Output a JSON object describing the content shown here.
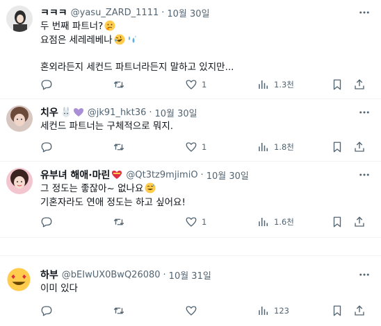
{
  "tweets": [
    {
      "name": "ㅋㅋㅋ",
      "handle": "@yasu_ZARD_1111",
      "time": "10월 30일",
      "lines": [
        "두 번째 파트너?",
        "요점은 세레레베나",
        "",
        "혼외라든지 세컨드 파트너라든지 말하고 있지만..."
      ],
      "reply_count": "",
      "retweet_count": "",
      "like_count": "1",
      "views": "1.3천"
    },
    {
      "name": "치우",
      "handle": "@jk91_hkt36",
      "time": "10월 30일",
      "lines": [
        "세컨드 파트너는 구체적으로 뭐지."
      ],
      "reply_count": "",
      "retweet_count": "",
      "like_count": "1",
      "views": "1.8천"
    },
    {
      "name": "유부녀 해애·마린",
      "handle": "@Qt3tz9mjimiO",
      "time": "10월 30일",
      "lines": [
        "그 정도는 좋잖아~ 없나요",
        "기혼자라도 연애 정도는 하고 싶어요!"
      ],
      "reply_count": "",
      "retweet_count": "",
      "like_count": "1",
      "views": "1.6천"
    },
    {
      "name": "하부",
      "handle": "@bEIwUX0BwQ26080",
      "time": "10월 31일",
      "lines": [
        "이미 있다"
      ],
      "reply_count": "",
      "retweet_count": "",
      "like_count": "",
      "views": "123"
    }
  ],
  "colors": {
    "text": "#0f1419",
    "muted": "#536471",
    "separator": "#eff3f4"
  },
  "icons": [
    "reply-icon",
    "retweet-icon",
    "like-icon",
    "views-icon",
    "bookmark-icon",
    "share-icon",
    "more-icon"
  ]
}
